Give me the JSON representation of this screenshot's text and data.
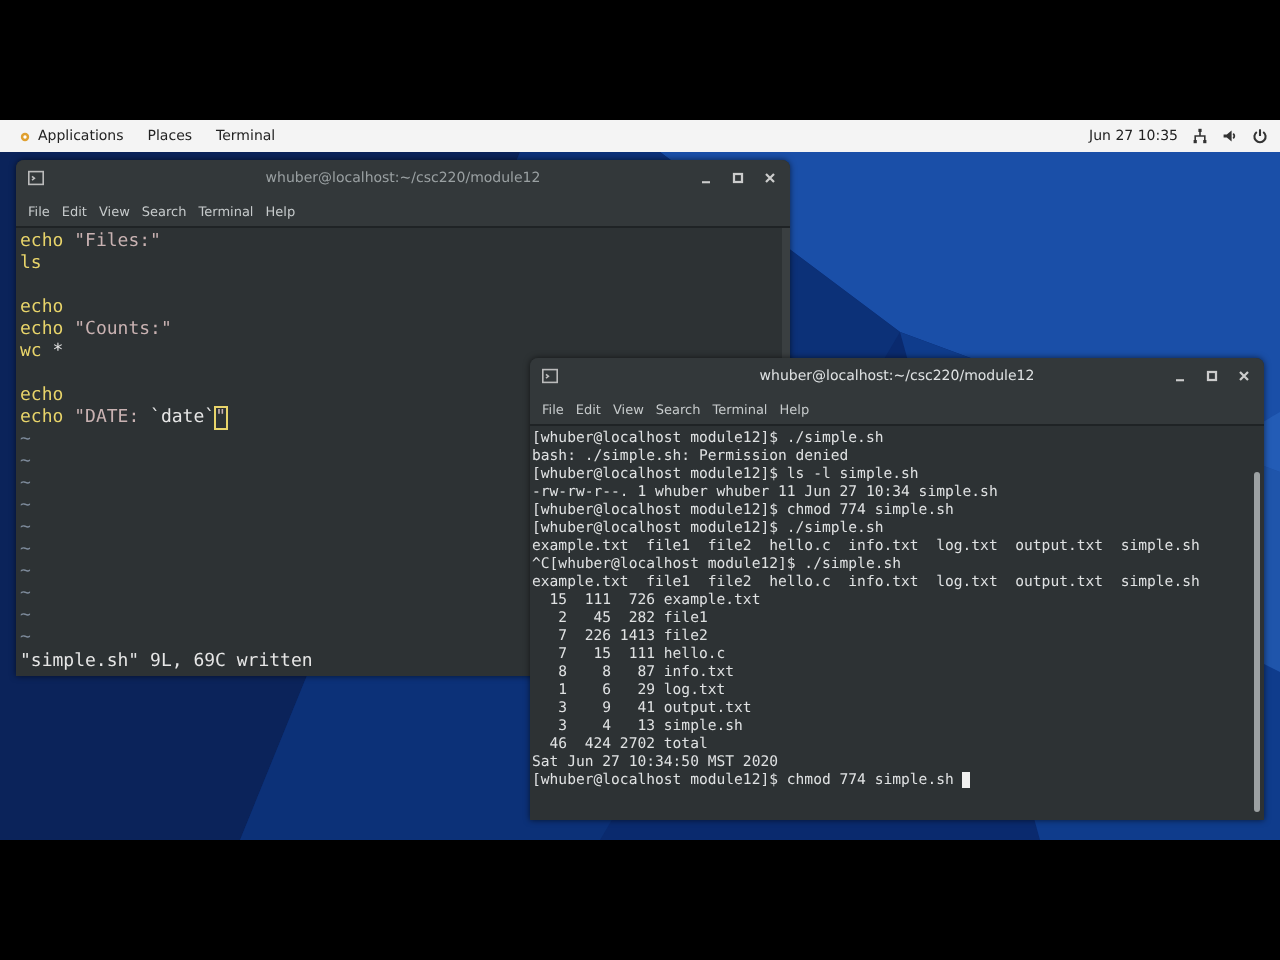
{
  "top_bar": {
    "menus": [
      {
        "label": "Applications",
        "icon": true
      },
      {
        "label": "Places",
        "icon": false
      },
      {
        "label": "Terminal",
        "icon": false
      }
    ],
    "clock": "Jun 27  10:35"
  },
  "windows": [
    {
      "title": "whuber@localhost:~/csc220/module12",
      "active": false,
      "menu": [
        "File",
        "Edit",
        "View",
        "Search",
        "Terminal",
        "Help"
      ],
      "kind": "vim",
      "lines": [
        {
          "kind": "code",
          "tokens": [
            {
              "kind": "keyword",
              "text": "echo"
            },
            {
              "kind": "string",
              "text": " \"Files:\""
            }
          ]
        },
        {
          "kind": "code",
          "tokens": [
            {
              "kind": "keyword",
              "text": "ls"
            }
          ]
        },
        {
          "kind": "blank"
        },
        {
          "kind": "code",
          "tokens": [
            {
              "kind": "keyword",
              "text": "echo"
            }
          ]
        },
        {
          "kind": "code",
          "tokens": [
            {
              "kind": "keyword",
              "text": "echo"
            },
            {
              "kind": "string",
              "text": " \"Counts:\""
            }
          ]
        },
        {
          "kind": "code",
          "tokens": [
            {
              "kind": "keyword",
              "text": "wc"
            },
            {
              "kind": "plain",
              "text": " *"
            }
          ]
        },
        {
          "kind": "blank"
        },
        {
          "kind": "code",
          "tokens": [
            {
              "kind": "keyword",
              "text": "echo"
            }
          ]
        },
        {
          "kind": "code",
          "tokens": [
            {
              "kind": "keyword",
              "text": "echo"
            },
            {
              "kind": "string",
              "text": " \"DATE: "
            },
            {
              "kind": "plain",
              "text": "`date`"
            },
            {
              "kind": "cursor",
              "text": "\""
            }
          ]
        }
      ],
      "tildes": [
        "~",
        "~",
        "~",
        "~",
        "~",
        "~",
        "~",
        "~",
        "~",
        "~"
      ],
      "status": "\"simple.sh\" 9L, 69C written"
    },
    {
      "title": "whuber@localhost:~/csc220/module12",
      "active": true,
      "menu": [
        "File",
        "Edit",
        "View",
        "Search",
        "Terminal",
        "Help"
      ],
      "kind": "terminal",
      "lines": [
        {
          "text": "[whuber@localhost module12]$ ./simple.sh",
          "cursor": false
        },
        {
          "text": "bash: ./simple.sh: Permission denied",
          "cursor": false
        },
        {
          "text": "[whuber@localhost module12]$ ls -l simple.sh",
          "cursor": false
        },
        {
          "text": "-rw-rw-r--. 1 whuber whuber 11 Jun 27 10:34 simple.sh",
          "cursor": false
        },
        {
          "text": "[whuber@localhost module12]$ chmod 774 simple.sh",
          "cursor": false
        },
        {
          "text": "[whuber@localhost module12]$ ./simple.sh",
          "cursor": false
        },
        {
          "text": "example.txt  file1  file2  hello.c  info.txt  log.txt  output.txt  simple.sh",
          "cursor": false
        },
        {
          "text": "^C[whuber@localhost module12]$ ./simple.sh",
          "cursor": false
        },
        {
          "text": "example.txt  file1  file2  hello.c  info.txt  log.txt  output.txt  simple.sh",
          "cursor": false
        },
        {
          "text": "  15  111  726 example.txt",
          "cursor": false
        },
        {
          "text": "   2   45  282 file1",
          "cursor": false
        },
        {
          "text": "   7  226 1413 file2",
          "cursor": false
        },
        {
          "text": "   7   15  111 hello.c",
          "cursor": false
        },
        {
          "text": "   8    8   87 info.txt",
          "cursor": false
        },
        {
          "text": "   1    6   29 log.txt",
          "cursor": false
        },
        {
          "text": "   3    9   41 output.txt",
          "cursor": false
        },
        {
          "text": "   3    4   13 simple.sh",
          "cursor": false
        },
        {
          "text": "  46  424 2702 total",
          "cursor": false
        },
        {
          "text": "Sat Jun 27 10:34:50 MST 2020",
          "cursor": false
        },
        {
          "text": "[whuber@localhost module12]$ chmod 774 simple.sh ",
          "cursor": true
        }
      ]
    }
  ]
}
